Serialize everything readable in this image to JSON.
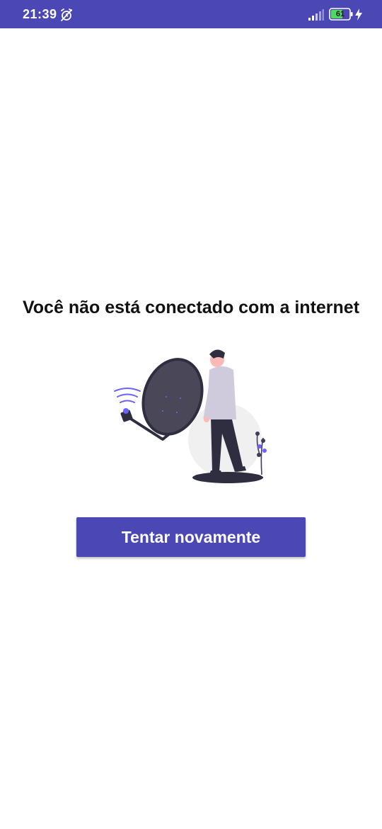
{
  "status_bar": {
    "time": "21:39",
    "battery_level": "61",
    "icons": [
      "alarm-off-icon",
      "signal-icon",
      "battery-icon",
      "charging-icon"
    ]
  },
  "main": {
    "message": "Você não está conectado com a internet",
    "illustration": "person-with-satellite-dish-illustration",
    "retry_label": "Tentar novamente"
  },
  "colors": {
    "primary": "#4b47b5",
    "dish": "#4a4758",
    "shirt": "#cfcbdc",
    "accent": "#6c63ff"
  }
}
